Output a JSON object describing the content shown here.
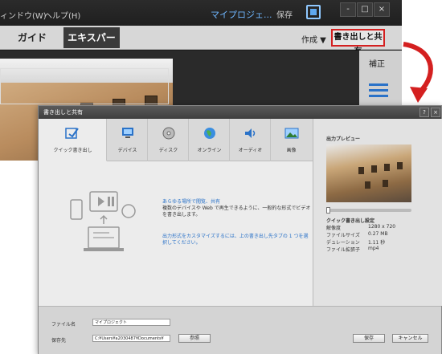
{
  "app": {
    "menu": [
      "ィンドウ(W)",
      "ヘルプ(H)"
    ],
    "project_name": "マイプロジェ...",
    "save_label": "保存",
    "window_buttons": [
      "-",
      "□",
      "×"
    ],
    "tabs": {
      "guide": "ガイド",
      "expert": "エキスパート"
    },
    "create_label": "作成 ▼",
    "share_label": "書き出しと共有",
    "panel_right_label": "補正"
  },
  "dialog": {
    "title": "書き出しと共有",
    "help": "?",
    "close": "×",
    "tabs": [
      {
        "label": "クイック書き出し",
        "icon": "quick-export-icon"
      },
      {
        "label": "デバイス",
        "icon": "devices-icon"
      },
      {
        "label": "ディスク",
        "icon": "disc-icon"
      },
      {
        "label": "オンライン",
        "icon": "globe-icon"
      },
      {
        "label": "オーディオ",
        "icon": "speaker-icon"
      },
      {
        "label": "画像",
        "icon": "image-icon"
      }
    ],
    "content": {
      "link_title": "あらゆる場所で閲覧、共有",
      "description": "複数のデバイスや Web で再生できるように、一般的な形式でビデオを書き出します。",
      "hint": "出力形式をカスタマイズするには、上の書き出し先タブの 1 つを選択してください。"
    },
    "side": {
      "preview_title": "出力プレビュー",
      "settings_title": "クイック書き出し設定",
      "settings": [
        {
          "label": "解像度",
          "value": "1280 x 720"
        },
        {
          "label": "ファイルサイズ",
          "value": "0.27 MB"
        },
        {
          "label": "デュレーション",
          "value": "1.11 秒"
        },
        {
          "label": "ファイル拡張子",
          "value": "mp4"
        }
      ]
    },
    "footer": {
      "filename_label": "ファイル名",
      "filename_value": "マイプロジェクト",
      "savein_label": "保存先",
      "savein_value": "C:¥Users¥a2030487¥Documents¥",
      "browse": "参照",
      "save": "保存",
      "cancel": "キャンセル"
    }
  }
}
